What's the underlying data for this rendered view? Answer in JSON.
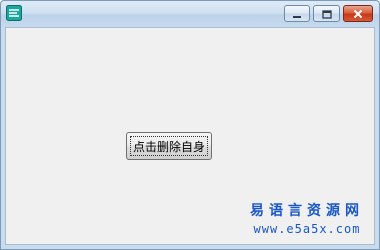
{
  "window": {
    "title": "",
    "controls": {
      "minimize": "minimize",
      "maximize": "maximize",
      "close": "close"
    }
  },
  "main": {
    "button_label": "点击删除自身"
  },
  "watermark": {
    "chinese": "易语言资源网",
    "url": "www.e5a5x.com"
  },
  "colors": {
    "title_accent": "#bcd2ea",
    "close_red": "#c8391a",
    "watermark_blue": "#1a57c8"
  },
  "icons": [
    "app-icon",
    "minimize-icon",
    "maximize-icon",
    "close-icon"
  ]
}
